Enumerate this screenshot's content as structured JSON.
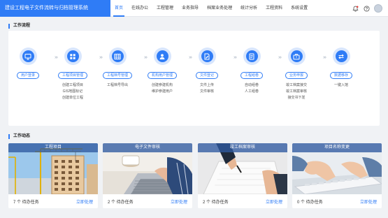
{
  "app": {
    "title": "建设工程电子文件流转与归档管理系统"
  },
  "nav": {
    "items": [
      {
        "label": "首页",
        "active": true
      },
      {
        "label": "在线办公"
      },
      {
        "label": "工程管理"
      },
      {
        "label": "业务指导"
      },
      {
        "label": "档案业务处理"
      },
      {
        "label": "统计分析"
      },
      {
        "label": "工程资料"
      },
      {
        "label": "系统设置"
      }
    ]
  },
  "colors": {
    "accent": "#2f7cf6",
    "notification_dot": "#e53935"
  },
  "workflow": {
    "title": "工作流程",
    "steps": [
      {
        "label": "用户登录",
        "icon": "monitor-icon",
        "subs": []
      },
      {
        "label": "工程项目管理",
        "icon": "grid-icon",
        "subs": [
          "创建工程项目",
          "GIS地图标记",
          "创建单位工程"
        ]
      },
      {
        "label": "工程档号管理",
        "icon": "table-icon",
        "subs": [
          "工程档号导出"
        ]
      },
      {
        "label": "机构用户管理",
        "icon": "user-icon",
        "subs": [
          "创建参建机构",
          "维护参建用户"
        ]
      },
      {
        "label": "文件登记",
        "icon": "document-edit-icon",
        "subs": [
          "文件上传",
          "文件审核"
        ]
      },
      {
        "label": "工程组卷",
        "icon": "document-list-icon",
        "subs": [
          "自动组卷",
          "人工组卷"
        ]
      },
      {
        "label": "业务申报",
        "icon": "briefcase-icon",
        "subs": [
          "竣工档案接交",
          "竣工档案审核",
          "接交书下发"
        ]
      },
      {
        "label": "数据移存",
        "icon": "transfer-icon",
        "subs": [
          "一键入馆"
        ]
      }
    ]
  },
  "dynamics": {
    "title": "工作动态",
    "cards": [
      {
        "title": "工程项目",
        "count": "7 个 待办任务",
        "action": "立即处理",
        "scene": "construction"
      },
      {
        "title": "电子文件审核",
        "count": "2 个 待办任务",
        "action": "立即处理",
        "scene": "laptop"
      },
      {
        "title": "竣工档案审核",
        "count": "2 个 待办任务",
        "action": "立即处理",
        "scene": "paper"
      },
      {
        "title": "项目名称变更",
        "count": "0 个 待办任务",
        "action": "立即处理",
        "scene": "keyboard"
      }
    ]
  }
}
